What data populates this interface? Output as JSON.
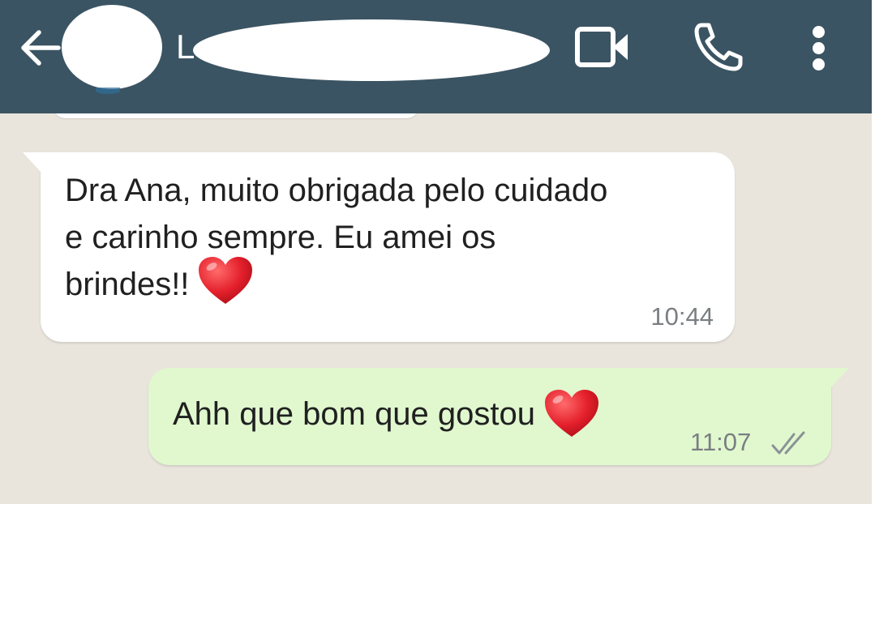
{
  "header": {
    "back_icon": "arrow-left-icon",
    "contact_initial": "L",
    "video_icon": "video-call-icon",
    "phone_icon": "phone-icon",
    "menu_icon": "more-vertical-icon",
    "background_color": "#3b5463"
  },
  "messages": [
    {
      "direction": "incoming",
      "text_lines": [
        "Dra Ana, muito obrigada pelo cuidado",
        "e carinho sempre. Eu amei os",
        "brindes!!"
      ],
      "emoji": "red-heart",
      "time": "10:44"
    },
    {
      "direction": "outgoing",
      "text": "Ahh que bom que gostou",
      "emoji": "red-heart",
      "time": "11:07",
      "status_icon": "double-check-icon"
    }
  ],
  "colors": {
    "chat_background": "#e9e4dc",
    "incoming_bubble": "#ffffff",
    "outgoing_bubble": "#e1f8cf",
    "timestamp": "#7a7f82",
    "heart": "#e4202c"
  }
}
